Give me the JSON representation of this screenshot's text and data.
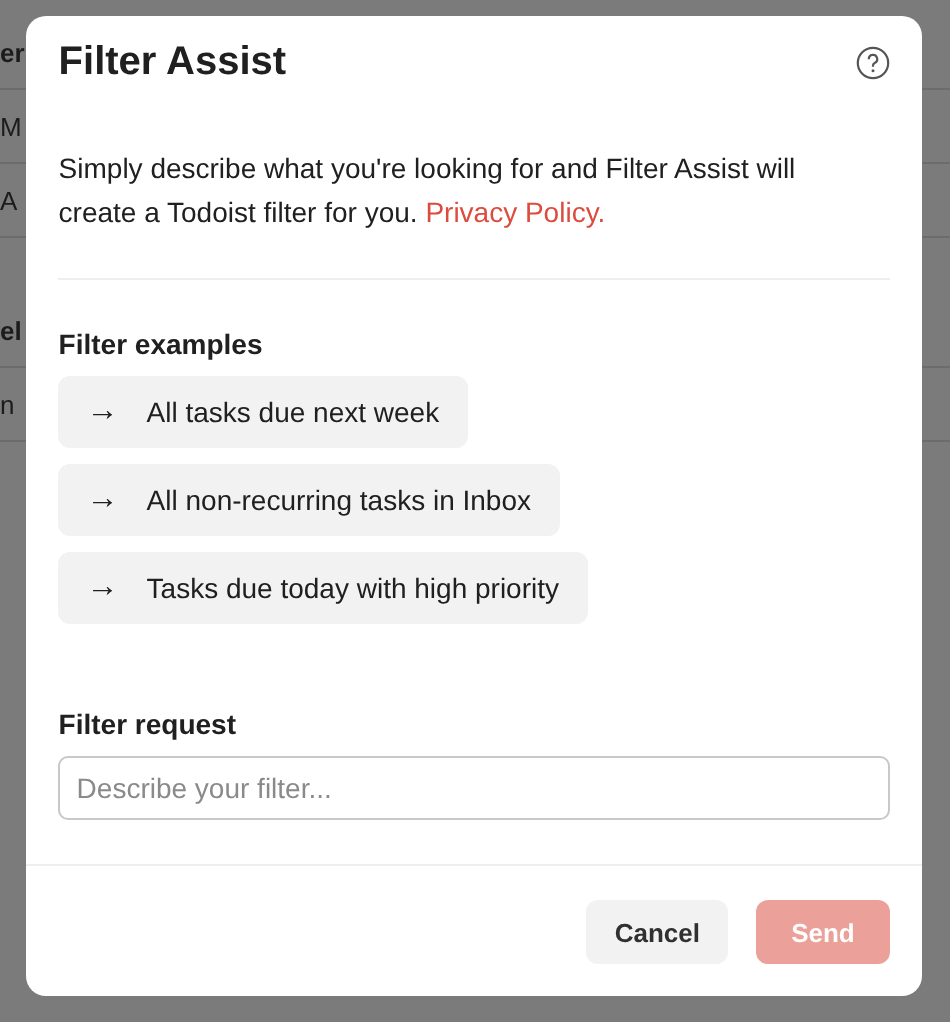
{
  "background": {
    "rows": [
      {
        "text": "er",
        "kind": "heading"
      },
      {
        "text": "M",
        "kind": "item"
      },
      {
        "text": "A",
        "kind": "item"
      },
      {
        "text": "el",
        "kind": "heading"
      },
      {
        "text": "n",
        "kind": "item"
      }
    ]
  },
  "dialog": {
    "title": "Filter Assist",
    "description": "Simply describe what you're looking for and Filter Assist will create a Todoist filter for you.",
    "privacy_link": "Privacy Policy.",
    "examples_title": "Filter examples",
    "examples": [
      {
        "icon": "→",
        "label": "All tasks due next week"
      },
      {
        "icon": "→",
        "label": "All non-recurring tasks in Inbox"
      },
      {
        "icon": "→",
        "label": "Tasks due today with high priority"
      }
    ],
    "request_label": "Filter request",
    "request_field": {
      "placeholder": "Describe your filter..."
    },
    "buttons": [
      {
        "label": "Cancel",
        "kind": "secondary",
        "disabled": false
      },
      {
        "label": "Send",
        "kind": "primary",
        "disabled": true
      }
    ]
  }
}
